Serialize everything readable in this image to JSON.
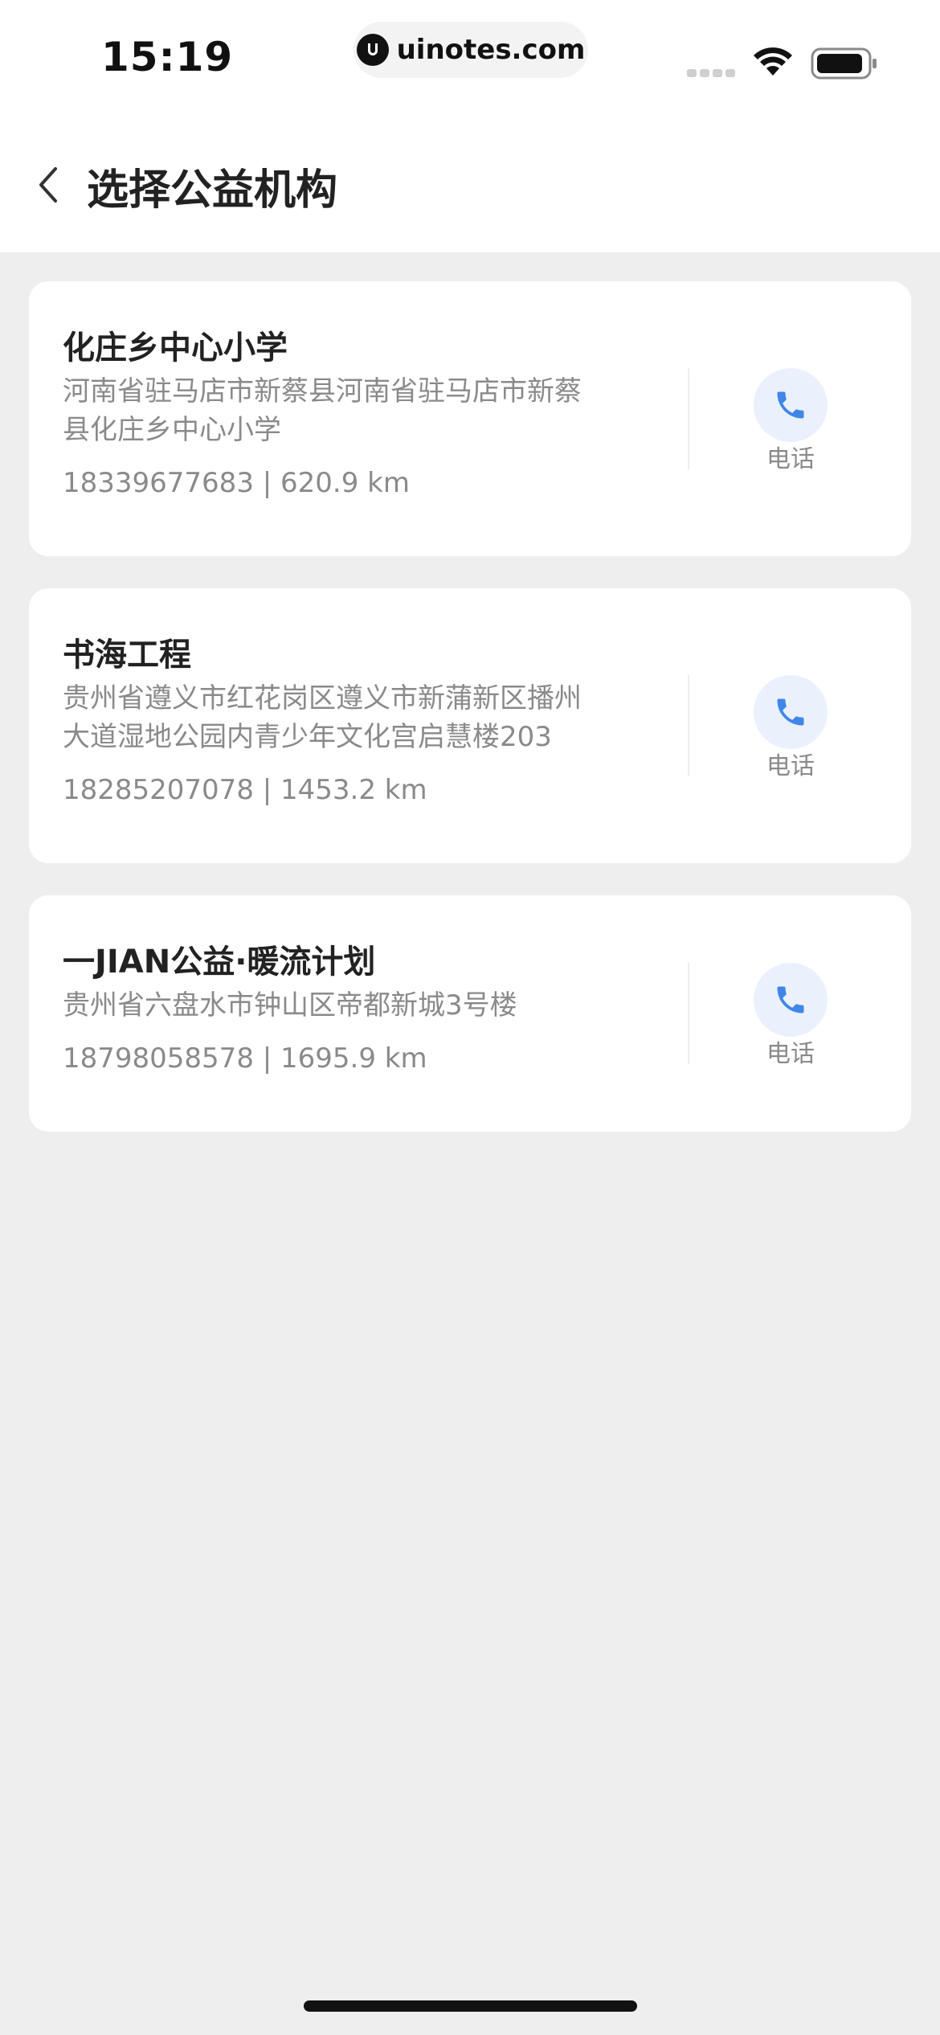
{
  "status_bar": {
    "time": "15:19",
    "url": "uinotes.com",
    "icons": [
      "signal-icon",
      "wifi-icon",
      "battery-icon"
    ]
  },
  "header": {
    "back_icon": "chevron-left-icon",
    "title": "选择公益机构"
  },
  "organizations": [
    {
      "name": "化庄乡中心小学",
      "address_lines": [
        "河南省驻马店市新蔡县河南省驻马店市新蔡",
        "县化庄乡中心小学"
      ],
      "meta": "18339677683 | 620.9 km",
      "call_label": "电话"
    },
    {
      "name": "书海工程",
      "address_lines": [
        "贵州省遵义市红花岗区遵义市新蒲新区播州",
        "大道湿地公园内青少年文化宫启慧楼203"
      ],
      "meta": "18285207078 | 1453.2 km",
      "call_label": "电话"
    },
    {
      "name": "一JIAN公益·暖流计划",
      "address_lines": [
        "贵州省六盘水市钟山区帝都新城3号楼"
      ],
      "meta": "18798058578 | 1695.9 km",
      "call_label": "电话"
    }
  ],
  "colors": {
    "background": "#eeeeee",
    "card": "#ffffff",
    "accent_blue": "#3f86e8",
    "call_bg": "#eaf1fd",
    "secondary_text": "#8a8a8a"
  }
}
